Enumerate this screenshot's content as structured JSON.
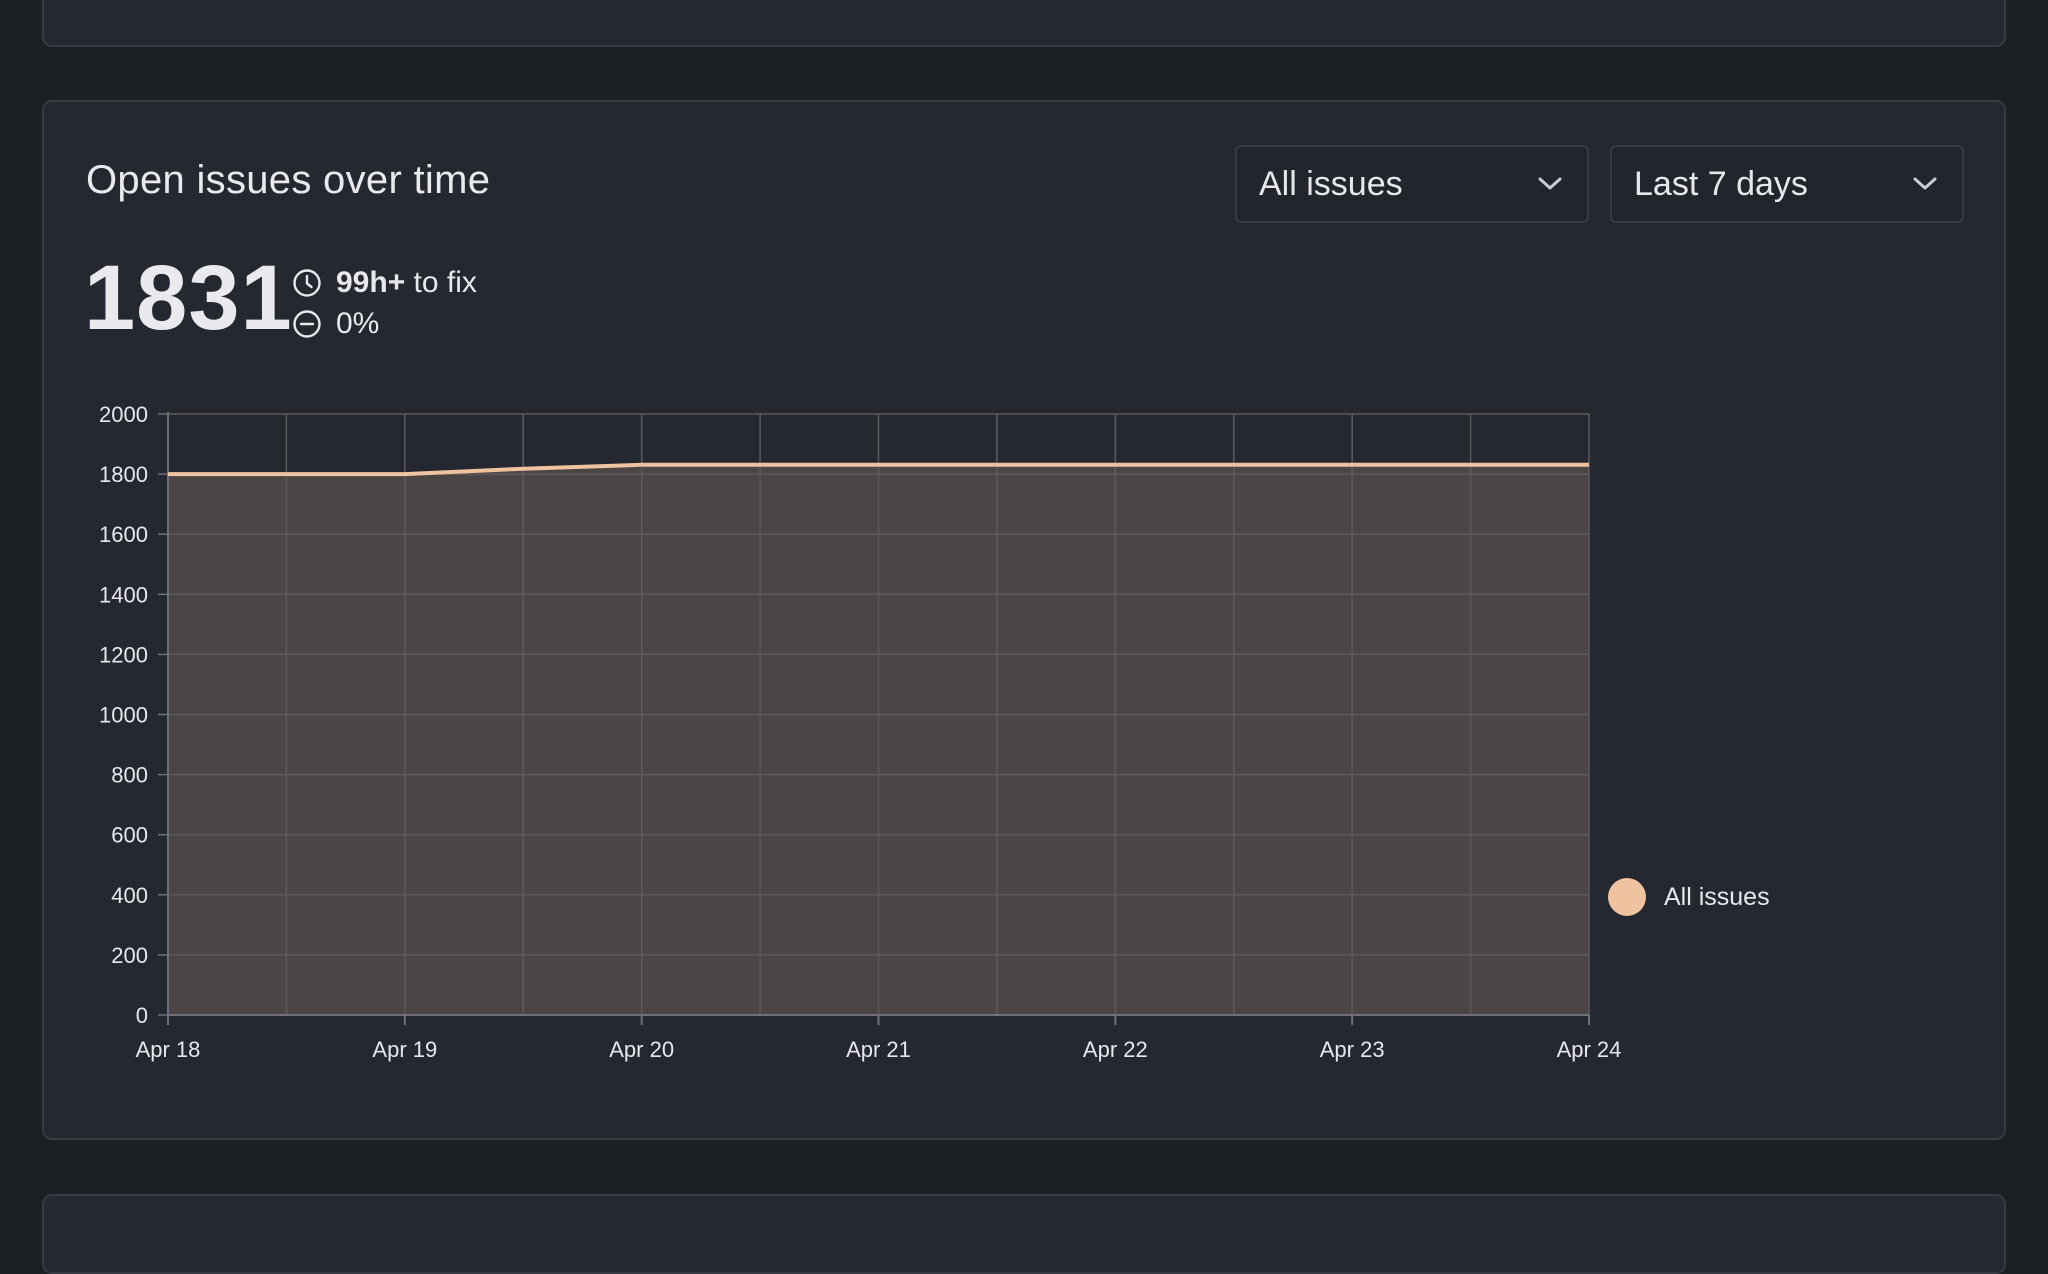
{
  "panel": {
    "title": "Open issues over time",
    "filters": [
      {
        "value": "All issues"
      },
      {
        "value": "Last 7 days"
      }
    ],
    "metric": "1831",
    "time_to_fix_bold": "99h+",
    "time_to_fix_suffix": " to fix",
    "change": "0%"
  },
  "colors": {
    "series": "#f0c3a0",
    "area": "#4b4545"
  },
  "icons": {
    "time": "clock-icon",
    "change": "minus-circle-icon",
    "dropdown": "chevron-down-icon"
  },
  "chart_data": {
    "type": "area",
    "x": [
      "Apr 18",
      "Apr 19",
      "Apr 20",
      "Apr 21",
      "Apr 22",
      "Apr 23",
      "Apr 24"
    ],
    "series": [
      {
        "name": "All issues",
        "x": [
          "Apr 18",
          "Apr 18 12:00",
          "Apr 19",
          "Apr 19 12:00",
          "Apr 20",
          "Apr 20 12:00",
          "Apr 21",
          "Apr 21 12:00",
          "Apr 22",
          "Apr 22 12:00",
          "Apr 23",
          "Apr 23 12:00",
          "Apr 24"
        ],
        "values": [
          1800,
          1800,
          1800,
          1818,
          1831,
          1831,
          1831,
          1831,
          1831,
          1831,
          1831,
          1831,
          1831
        ]
      }
    ],
    "y_ticks": [
      0,
      200,
      400,
      600,
      800,
      1000,
      1200,
      1400,
      1600,
      1800,
      2000
    ],
    "ylim": [
      0,
      2000
    ],
    "grid": true,
    "legend": "right-bottom"
  }
}
